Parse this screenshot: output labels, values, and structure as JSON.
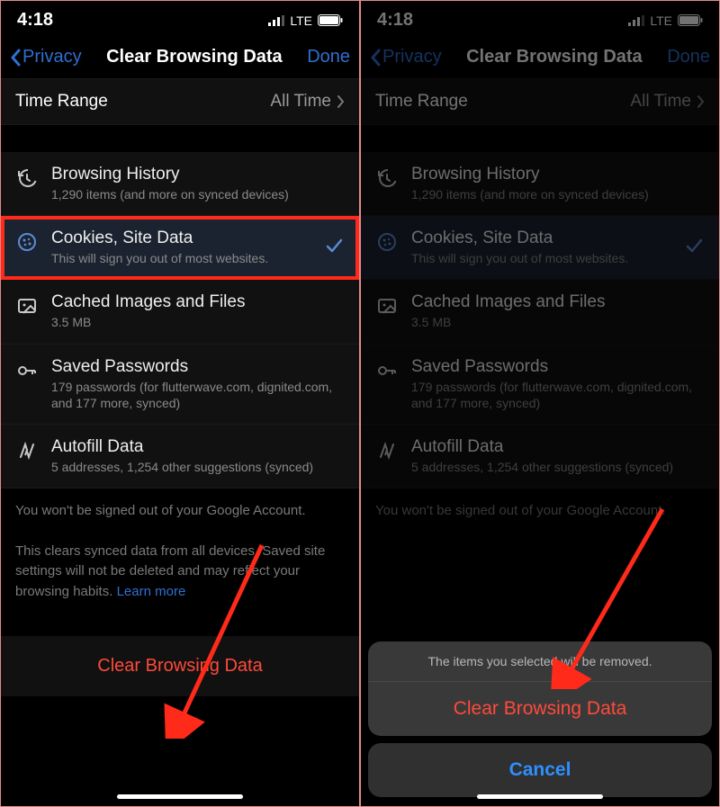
{
  "statusbar": {
    "time": "4:18",
    "network": "LTE"
  },
  "navbar": {
    "back": "Privacy",
    "title": "Clear Browsing Data",
    "done": "Done"
  },
  "time_range": {
    "label": "Time Range",
    "value": "All Time"
  },
  "items": {
    "history": {
      "title": "Browsing History",
      "sub": "1,290 items (and more on synced devices)"
    },
    "cookies": {
      "title": "Cookies, Site Data",
      "sub": "This will sign you out of most websites."
    },
    "cache": {
      "title": "Cached Images and Files",
      "sub": "3.5 MB"
    },
    "passwords": {
      "title": "Saved Passwords",
      "sub": "179 passwords (for flutterwave.com, dignited.com, and 177 more, synced)"
    },
    "autofill": {
      "title": "Autofill Data",
      "sub": "5 addresses, 1,254 other suggestions (synced)"
    }
  },
  "footer": {
    "line1": "You won't be signed out of your Google Account.",
    "line2": "This clears synced data from all devices. Saved site settings will not be deleted and may reflect your browsing habits.",
    "learn_more": "Learn more"
  },
  "clear_button": "Clear Browsing Data",
  "actionsheet": {
    "message": "The items you selected will be removed.",
    "clear": "Clear Browsing Data",
    "cancel": "Cancel"
  },
  "colors": {
    "accent": "#2f6fd1",
    "destructive": "#ff4a3a"
  }
}
